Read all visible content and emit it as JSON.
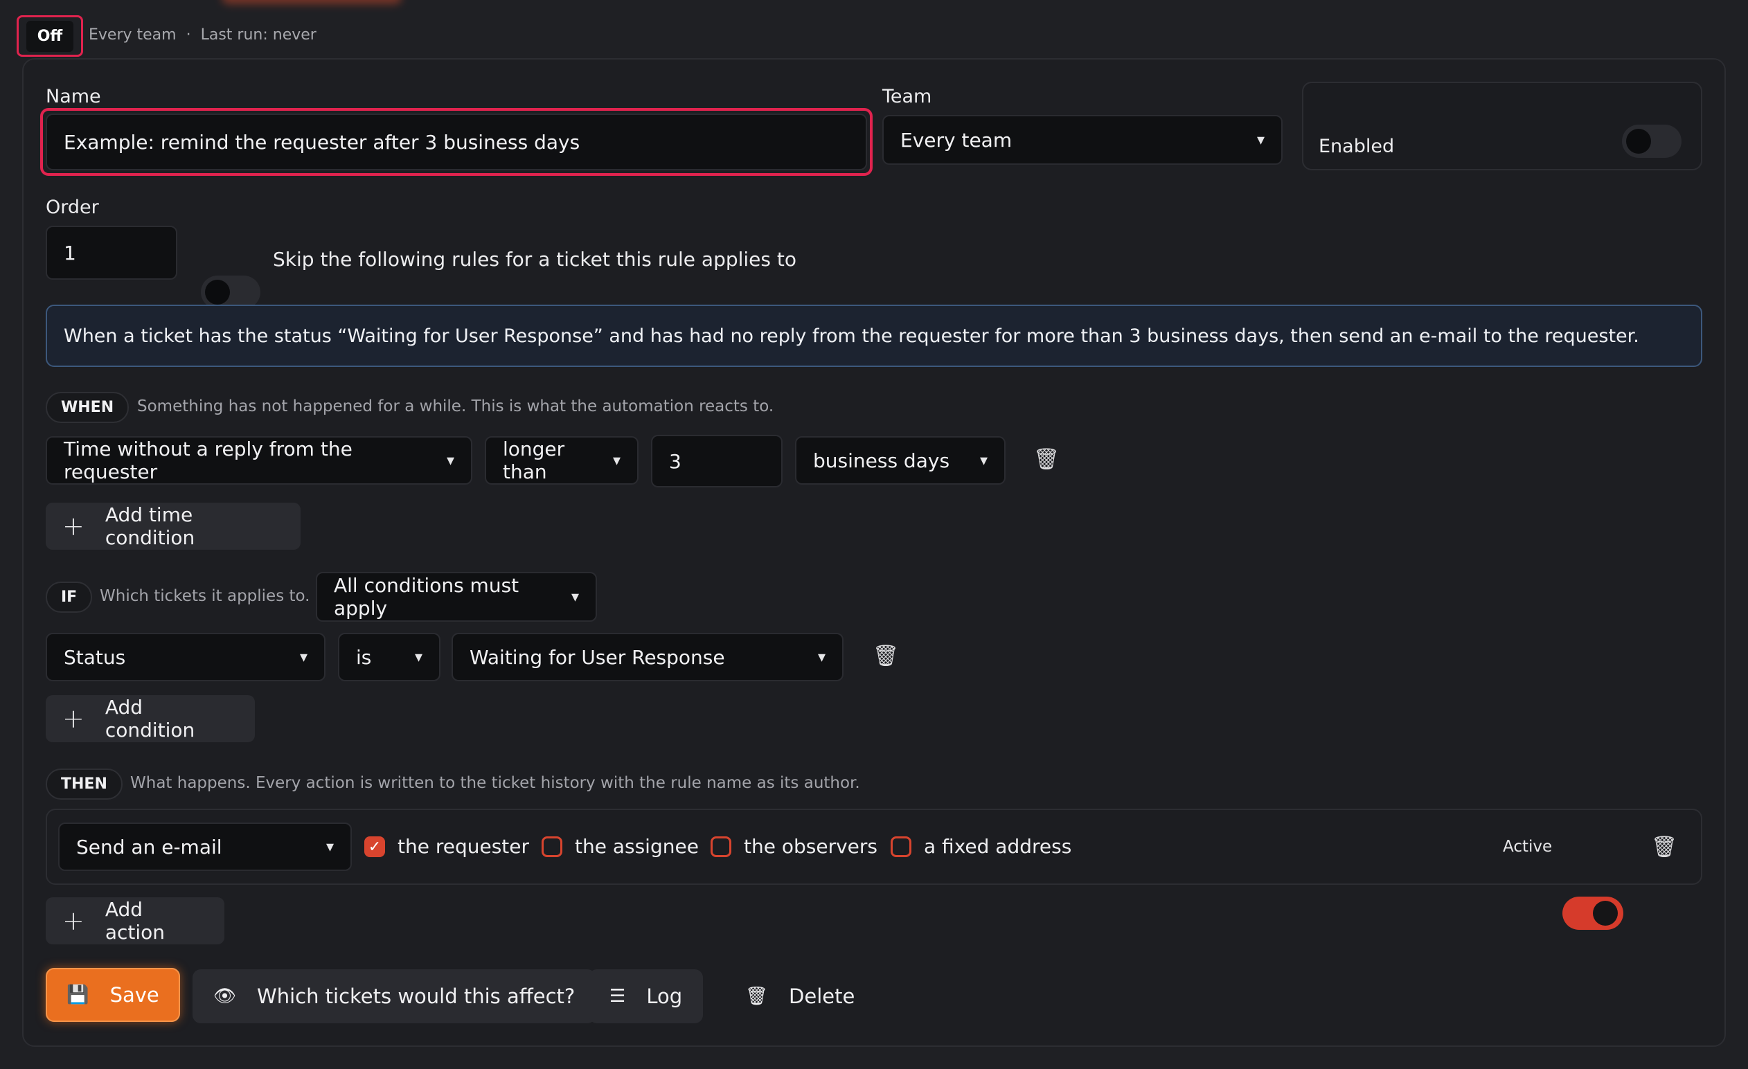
{
  "header": {
    "status": "Off",
    "team_meta": "Every team",
    "separator": "·",
    "last_run": "Last run: never"
  },
  "form": {
    "name_label": "Name",
    "name_value": "Example: remind the requester after 3 business days",
    "team_label": "Team",
    "team_value": "Every team",
    "enabled_label": "Enabled",
    "enabled": false,
    "order_label": "Order",
    "order_value": "1",
    "skip_label": "Skip the following rules for a ticket this rule applies to",
    "skip_enabled": false,
    "description": "When a ticket has the status “Waiting for User Response” and has had no reply from the requester for more than 3 business days, then send an e-mail to the requester."
  },
  "when": {
    "tag": "WHEN",
    "hint": "Something has not happened for a while. This is what the automation reacts to.",
    "condition": {
      "field": "Time without a reply from the requester",
      "operator": "longer than",
      "amount": "3",
      "unit": "business days"
    },
    "add_label": "Add time condition"
  },
  "if": {
    "tag": "IF",
    "hint": "Which tickets it applies to.",
    "mode": "All conditions must apply",
    "condition": {
      "field": "Status",
      "operator": "is",
      "value": "Waiting for User Response"
    },
    "add_label": "Add condition"
  },
  "then": {
    "tag": "THEN",
    "hint": "What happens. Every action is written to the ticket history with the rule name as its author.",
    "action": "Send an e-mail",
    "recipients": [
      {
        "label": "the requester",
        "checked": true
      },
      {
        "label": "the assignee",
        "checked": false
      },
      {
        "label": "the observers",
        "checked": false
      },
      {
        "label": "a fixed address",
        "checked": false
      }
    ],
    "active_label": "Active",
    "active": true,
    "add_label": "Add action"
  },
  "footer": {
    "save": "Save",
    "preview": "Which tickets would this affect?",
    "log": "Log",
    "delete": "Delete"
  },
  "colors": {
    "accent": "#ea6f1f",
    "highlight": "#e0234e",
    "info_border": "#3c587c"
  },
  "icons": {
    "chevron": "chevron-down-icon",
    "trash": "trash-icon",
    "plus": "plus-icon",
    "save": "floppy-icon",
    "eye": "eye-icon",
    "log": "list-check-icon"
  }
}
